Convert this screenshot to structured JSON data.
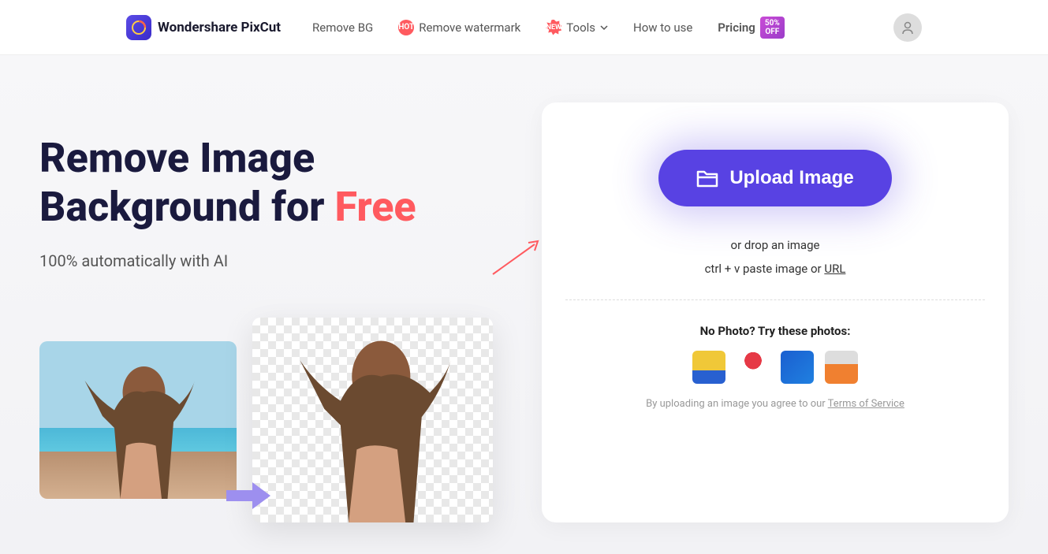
{
  "brand": "Wondershare PixCut",
  "nav": {
    "removeBg": "Remove BG",
    "removeWatermark": "Remove watermark",
    "tools": "Tools",
    "howToUse": "How to use",
    "pricing": "Pricing",
    "hotBadge": "HOT",
    "newBadge": "NEW",
    "offBadge": "50% OFF"
  },
  "hero": {
    "titlePrefix": "Remove Image Background for ",
    "titleAccent": "Free",
    "subtitle": "100% automatically with AI"
  },
  "upload": {
    "button": "Upload Image",
    "dropText": "or drop an image",
    "pastePrefix": "ctrl + v paste image or ",
    "urlLabel": "URL",
    "noPhoto": "No Photo? Try these photos:",
    "tosPrefix": "By uploading an image you agree to our ",
    "tosLink": "Terms of Service"
  }
}
